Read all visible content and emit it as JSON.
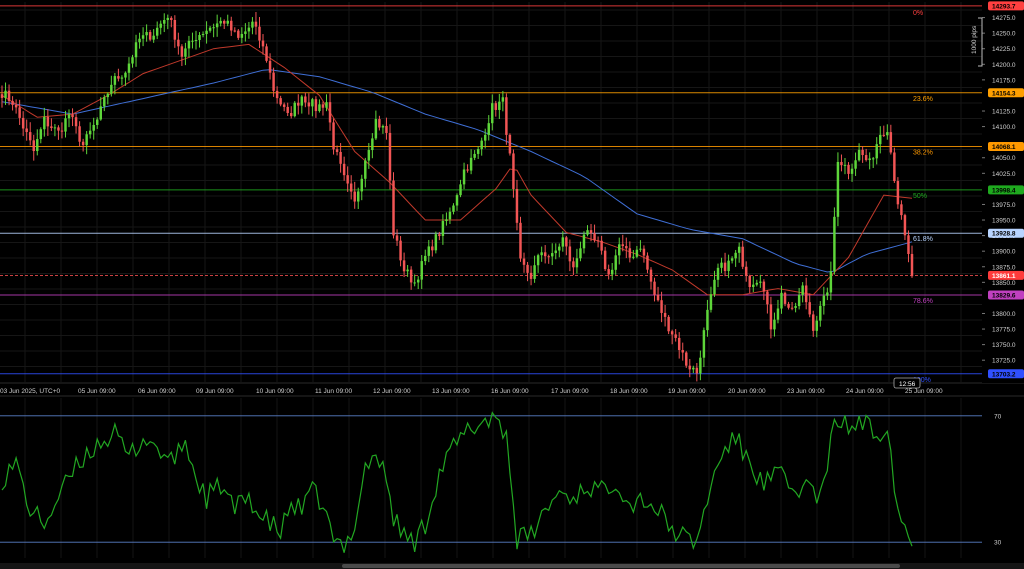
{
  "chart_data": [
    {
      "type": "candlestick",
      "ylim": [
        13690,
        14300
      ],
      "y_ticks": [
        "14275.0",
        "14250.0",
        "14225.0",
        "14200.0",
        "14175.0",
        "14125.0",
        "14100.0",
        "14050.0",
        "14025.0",
        "13975.0",
        "13950.0",
        "13925.0",
        "13900.0",
        "13875.0",
        "13850.0",
        "13800.0",
        "13775.0",
        "13750.0",
        "13725.0"
      ],
      "x_ticks": [
        "03 Jun 2025, UTC+0",
        "05 Jun 09:00",
        "06 Jun 09:00",
        "09 Jun 09:00",
        "10 Jun 09:00",
        "11 Jun 09:00",
        "12 Jun 09:00",
        "13 Jun 09:00",
        "16 Jun 09:00",
        "17 Jun 09:00",
        "18 Jun 09:00",
        "19 Jun 09:00",
        "20 Jun 09:00",
        "23 Jun 09:00",
        "24 Jun 09:00",
        "25 Jun 09:00"
      ],
      "scale_note": "1000 pips",
      "time_badge": "12:56",
      "current_price": "13861.1",
      "fib_levels": [
        {
          "label": "0%",
          "value": 14293.7,
          "badge": "14293.7",
          "color": "#ff4040"
        },
        {
          "label": "23.6%",
          "value": 14154.3,
          "badge": "14154.3",
          "color": "#ffa000"
        },
        {
          "label": "38.2%",
          "value": 14068.1,
          "badge": "14068.1",
          "color": "#ff9900"
        },
        {
          "label": "50%",
          "value": 13998.4,
          "badge": "13998.4",
          "color": "#1faa1f"
        },
        {
          "label": "61.8%",
          "value": 13928.8,
          "badge": "13928.8",
          "color": "#b8d4ff"
        },
        {
          "label": "78.6%",
          "value": 13829.6,
          "badge": "13829.6",
          "color": "#c040c0"
        },
        {
          "label": "100%",
          "value": 13703.2,
          "badge": "13703.2",
          "color": "#3050ff"
        }
      ],
      "close_anchors": [
        [
          0,
          14155
        ],
        [
          3,
          14140
        ],
        [
          6,
          14100
        ],
        [
          9,
          14060
        ],
        [
          12,
          14110
        ],
        [
          16,
          14090
        ],
        [
          19,
          14120
        ],
        [
          23,
          14070
        ],
        [
          27,
          14110
        ],
        [
          31,
          14170
        ],
        [
          35,
          14190
        ],
        [
          39,
          14240
        ],
        [
          43,
          14250
        ],
        [
          47,
          14280
        ],
        [
          51,
          14215
        ],
        [
          55,
          14245
        ],
        [
          59,
          14260
        ],
        [
          63,
          14270
        ],
        [
          67,
          14240
        ],
        [
          71,
          14265
        ],
        [
          73,
          14240
        ],
        [
          75,
          14210
        ],
        [
          77,
          14160
        ],
        [
          81,
          14115
        ],
        [
          85,
          14150
        ],
        [
          89,
          14130
        ],
        [
          92,
          14140
        ],
        [
          94,
          14070
        ],
        [
          97,
          14015
        ],
        [
          100,
          13975
        ],
        [
          103,
          14050
        ],
        [
          106,
          14110
        ],
        [
          109,
          14090
        ],
        [
          111,
          13930
        ],
        [
          114,
          13870
        ],
        [
          117,
          13850
        ],
        [
          120,
          13890
        ],
        [
          123,
          13920
        ],
        [
          127,
          13960
        ],
        [
          131,
          14030
        ],
        [
          135,
          14060
        ],
        [
          139,
          14130
        ],
        [
          142,
          14140
        ],
        [
          144,
          14050
        ],
        [
          147,
          13880
        ],
        [
          150,
          13860
        ],
        [
          153,
          13900
        ],
        [
          156,
          13890
        ],
        [
          159,
          13920
        ],
        [
          162,
          13870
        ],
        [
          165,
          13930
        ],
        [
          169,
          13910
        ],
        [
          172,
          13860
        ],
        [
          175,
          13910
        ],
        [
          178,
          13890
        ],
        [
          181,
          13910
        ],
        [
          185,
          13830
        ],
        [
          188,
          13790
        ],
        [
          191,
          13760
        ],
        [
          194,
          13720
        ],
        [
          197,
          13705
        ],
        [
          200,
          13800
        ],
        [
          203,
          13870
        ],
        [
          206,
          13880
        ],
        [
          209,
          13900
        ],
        [
          212,
          13850
        ],
        [
          215,
          13860
        ],
        [
          218,
          13780
        ],
        [
          221,
          13830
        ],
        [
          224,
          13800
        ],
        [
          227,
          13840
        ],
        [
          230,
          13780
        ],
        [
          233,
          13820
        ],
        [
          235,
          13860
        ],
        [
          237,
          14050
        ],
        [
          240,
          14030
        ],
        [
          243,
          14060
        ],
        [
          246,
          14040
        ],
        [
          249,
          14090
        ],
        [
          251,
          14100
        ],
        [
          254,
          13980
        ],
        [
          258,
          13861
        ]
      ],
      "sma_fast_anchors": [
        [
          0,
          14150
        ],
        [
          10,
          14115
        ],
        [
          20,
          14120
        ],
        [
          30,
          14150
        ],
        [
          40,
          14185
        ],
        [
          50,
          14205
        ],
        [
          60,
          14225
        ],
        [
          70,
          14232
        ],
        [
          80,
          14195
        ],
        [
          90,
          14150
        ],
        [
          100,
          14060
        ],
        [
          110,
          14010
        ],
        [
          120,
          13950
        ],
        [
          130,
          13950
        ],
        [
          140,
          14000
        ],
        [
          145,
          14040
        ],
        [
          150,
          13990
        ],
        [
          160,
          13930
        ],
        [
          170,
          13915
        ],
        [
          180,
          13895
        ],
        [
          190,
          13870
        ],
        [
          200,
          13830
        ],
        [
          210,
          13830
        ],
        [
          220,
          13840
        ],
        [
          230,
          13830
        ],
        [
          240,
          13890
        ],
        [
          250,
          13990
        ],
        [
          258,
          13985
        ]
      ],
      "sma_slow_anchors": [
        [
          0,
          14140
        ],
        [
          20,
          14120
        ],
        [
          40,
          14145
        ],
        [
          60,
          14170
        ],
        [
          75,
          14192
        ],
        [
          90,
          14180
        ],
        [
          105,
          14155
        ],
        [
          120,
          14120
        ],
        [
          135,
          14095
        ],
        [
          150,
          14060
        ],
        [
          165,
          14020
        ],
        [
          180,
          13960
        ],
        [
          195,
          13935
        ],
        [
          210,
          13920
        ],
        [
          225,
          13880
        ],
        [
          235,
          13865
        ],
        [
          245,
          13895
        ],
        [
          258,
          13915
        ]
      ],
      "indicator": {
        "ylim": [
          25,
          75
        ],
        "levels": [
          70,
          30
        ],
        "level_labels": [
          "70",
          "30"
        ],
        "anchors": [
          [
            0,
            50
          ],
          [
            4,
            55
          ],
          [
            8,
            40
          ],
          [
            12,
            36
          ],
          [
            16,
            44
          ],
          [
            20,
            52
          ],
          [
            24,
            58
          ],
          [
            28,
            62
          ],
          [
            32,
            64
          ],
          [
            36,
            57
          ],
          [
            40,
            63
          ],
          [
            44,
            60
          ],
          [
            48,
            55
          ],
          [
            52,
            62
          ],
          [
            55,
            50
          ],
          [
            58,
            44
          ],
          [
            62,
            48
          ],
          [
            66,
            40
          ],
          [
            70,
            45
          ],
          [
            73,
            38
          ],
          [
            76,
            36
          ],
          [
            79,
            33
          ],
          [
            82,
            42
          ],
          [
            85,
            40
          ],
          [
            88,
            46
          ],
          [
            91,
            42
          ],
          [
            94,
            30
          ],
          [
            97,
            28
          ],
          [
            100,
            36
          ],
          [
            103,
            54
          ],
          [
            106,
            58
          ],
          [
            109,
            50
          ],
          [
            111,
            38
          ],
          [
            114,
            32
          ],
          [
            117,
            30
          ],
          [
            120,
            36
          ],
          [
            124,
            52
          ],
          [
            128,
            60
          ],
          [
            132,
            65
          ],
          [
            136,
            68
          ],
          [
            140,
            70
          ],
          [
            143,
            64
          ],
          [
            146,
            31
          ],
          [
            150,
            32
          ],
          [
            154,
            40
          ],
          [
            158,
            46
          ],
          [
            162,
            44
          ],
          [
            166,
            48
          ],
          [
            170,
            46
          ],
          [
            174,
            50
          ],
          [
            178,
            42
          ],
          [
            182,
            44
          ],
          [
            186,
            40
          ],
          [
            190,
            34
          ],
          [
            194,
            31
          ],
          [
            197,
            30
          ],
          [
            200,
            44
          ],
          [
            204,
            58
          ],
          [
            208,
            63
          ],
          [
            212,
            55
          ],
          [
            216,
            48
          ],
          [
            220,
            52
          ],
          [
            224,
            46
          ],
          [
            228,
            48
          ],
          [
            232,
            44
          ],
          [
            234,
            52
          ],
          [
            236,
            70
          ],
          [
            240,
            66
          ],
          [
            244,
            68
          ],
          [
            248,
            64
          ],
          [
            251,
            68
          ],
          [
            254,
            40
          ],
          [
            258,
            30
          ]
        ]
      }
    }
  ]
}
